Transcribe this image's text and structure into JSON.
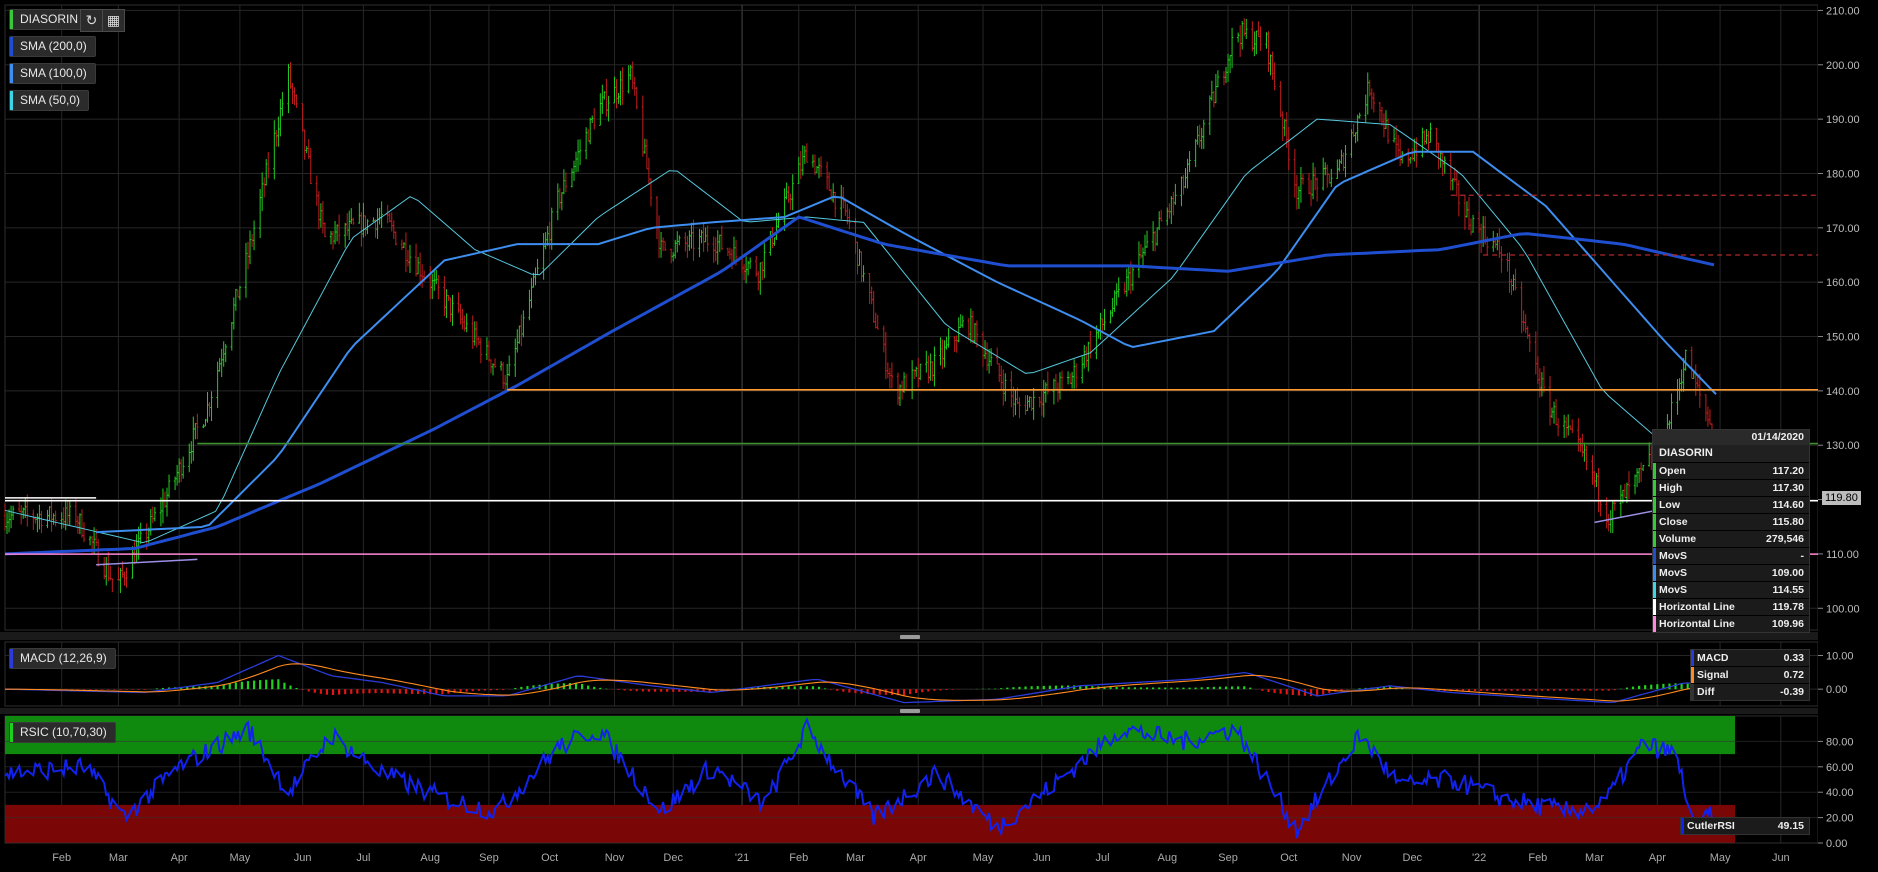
{
  "toolbar": {
    "symbol": "DIASORIN",
    "symbol_color": "#39c739",
    "indicators": [
      {
        "label": "SMA (200,0)",
        "color": "#1f4fd0"
      },
      {
        "label": "SMA (100,0)",
        "color": "#3d8ef0"
      },
      {
        "label": "SMA (50,0)",
        "color": "#3ed6e6"
      }
    ],
    "refresh_icon": "refresh-icon",
    "calendar_icon": "calendar-icon"
  },
  "colors": {
    "up": "#22cc22",
    "down": "#c21e1e",
    "grid": "#2c2c2c",
    "sma200": "#1f4fd0",
    "sma100": "#3d8ef0",
    "sma50": "#55c9dd",
    "orange_line": "#ff9933",
    "green_line": "#3e8f2e",
    "white_line": "#ffffff",
    "pink_line": "#ff88d8",
    "purple_line": "#9b8fe6",
    "red_dash": "#b02a2a",
    "macd": "#2a3bd8",
    "signal": "#ff8a1f",
    "rsi": "#1222ee",
    "overbought": "#0f8a0f",
    "oversold": "#7a0606"
  },
  "info_panel": {
    "date": "01/14/2020",
    "symbol": "DIASORIN",
    "rows": [
      {
        "label": "Open",
        "value": "117.20",
        "color": "#33cc33"
      },
      {
        "label": "High",
        "value": "117.30",
        "color": "#33cc33"
      },
      {
        "label": "Low",
        "value": "114.60",
        "color": "#33cc33"
      },
      {
        "label": "Close",
        "value": "115.80",
        "color": "#33cc33"
      },
      {
        "label": "Volume",
        "value": "279,546",
        "color": "#33cc33"
      },
      {
        "label": "MovS",
        "value": "-",
        "color": "#1f4fd0"
      },
      {
        "label": "MovS",
        "value": "109.00",
        "color": "#3d8ef0"
      },
      {
        "label": "MovS",
        "value": "114.55",
        "color": "#3ed6e6"
      },
      {
        "label": "Horizontal Line",
        "value": "119.78",
        "color": "#ffffff"
      },
      {
        "label": "Horizontal Line",
        "value": "109.96",
        "color": "#ff88d8"
      }
    ]
  },
  "price_tag": "119.80",
  "macd_panel": {
    "label": "MACD (12,26,9)",
    "label_color": "#2a3bd8",
    "rows": [
      {
        "label": "MACD",
        "value": "0.33",
        "color": "#2a3bd8"
      },
      {
        "label": "Signal",
        "value": "0.72",
        "color": "#ff8a1f"
      },
      {
        "label": "Diff",
        "value": "-0.39",
        "color": "#333333"
      }
    ]
  },
  "rsi_panel": {
    "label": "RSIC (10,70,30)",
    "label_color": "#1fd01f",
    "row": {
      "label": "CutlerRSI",
      "value": "49.15",
      "color": "#1222ee"
    }
  },
  "chart_data": {
    "type": "candlestick",
    "title": "DIASORIN",
    "x_tick_labels": [
      "Feb",
      "Mar",
      "Apr",
      "May",
      "Jun",
      "Jul",
      "Aug",
      "Sep",
      "Oct",
      "Nov",
      "Dec",
      "'21",
      "Feb",
      "Mar",
      "Apr",
      "May",
      "Jun",
      "Jul",
      "Aug",
      "Sep",
      "Oct",
      "Nov",
      "Dec",
      "'22",
      "Feb",
      "Mar",
      "Apr",
      "May",
      "Jun"
    ],
    "y_ticks": [
      "100.00",
      "110.00",
      "120.00",
      "130.00",
      "140.00",
      "150.00",
      "160.00",
      "170.00",
      "180.00",
      "190.00",
      "200.00",
      "210.00"
    ],
    "ylim": [
      96,
      211
    ],
    "price_path": [
      {
        "x": "2020-01-06",
        "y": 117
      },
      {
        "x": "2020-02-10",
        "y": 117
      },
      {
        "x": "2020-03-01",
        "y": 104
      },
      {
        "x": "2020-03-25",
        "y": 120
      },
      {
        "x": "2020-04-15",
        "y": 137
      },
      {
        "x": "2020-05-05",
        "y": 165
      },
      {
        "x": "2020-05-25",
        "y": 198
      },
      {
        "x": "2020-06-12",
        "y": 168
      },
      {
        "x": "2020-07-10",
        "y": 172
      },
      {
        "x": "2020-08-01",
        "y": 161
      },
      {
        "x": "2020-08-20",
        "y": 152
      },
      {
        "x": "2020-09-10",
        "y": 142
      },
      {
        "x": "2020-10-05",
        "y": 175
      },
      {
        "x": "2020-10-25",
        "y": 192
      },
      {
        "x": "2020-11-10",
        "y": 198
      },
      {
        "x": "2020-11-25",
        "y": 166
      },
      {
        "x": "2020-12-20",
        "y": 168
      },
      {
        "x": "2021-01-12",
        "y": 162
      },
      {
        "x": "2021-02-05",
        "y": 184
      },
      {
        "x": "2021-02-25",
        "y": 172
      },
      {
        "x": "2021-03-20",
        "y": 140
      },
      {
        "x": "2021-04-10",
        "y": 145
      },
      {
        "x": "2021-04-25",
        "y": 153
      },
      {
        "x": "2021-05-20",
        "y": 137
      },
      {
        "x": "2021-06-15",
        "y": 142
      },
      {
        "x": "2021-07-10",
        "y": 158
      },
      {
        "x": "2021-08-10",
        "y": 178
      },
      {
        "x": "2021-09-05",
        "y": 206
      },
      {
        "x": "2021-09-20",
        "y": 204
      },
      {
        "x": "2021-10-05",
        "y": 177
      },
      {
        "x": "2021-10-25",
        "y": 180
      },
      {
        "x": "2021-11-10",
        "y": 196
      },
      {
        "x": "2021-11-25",
        "y": 182
      },
      {
        "x": "2021-12-10",
        "y": 187
      },
      {
        "x": "2021-12-28",
        "y": 172
      },
      {
        "x": "2022-01-15",
        "y": 165
      },
      {
        "x": "2022-02-05",
        "y": 138
      },
      {
        "x": "2022-02-25",
        "y": 127
      },
      {
        "x": "2022-03-08",
        "y": 117
      },
      {
        "x": "2022-03-25",
        "y": 125
      },
      {
        "x": "2022-04-05",
        "y": 132
      },
      {
        "x": "2022-04-15",
        "y": 146
      },
      {
        "x": "2022-04-28",
        "y": 133
      }
    ],
    "sma50": [
      {
        "x": "2020-01-06",
        "y": 118
      },
      {
        "x": "2020-03-15",
        "y": 112
      },
      {
        "x": "2020-04-20",
        "y": 118
      },
      {
        "x": "2020-05-20",
        "y": 143
      },
      {
        "x": "2020-06-25",
        "y": 168
      },
      {
        "x": "2020-07-25",
        "y": 176
      },
      {
        "x": "2020-08-25",
        "y": 166
      },
      {
        "x": "2020-09-25",
        "y": 161
      },
      {
        "x": "2020-10-25",
        "y": 172
      },
      {
        "x": "2020-12-01",
        "y": 181
      },
      {
        "x": "2021-01-05",
        "y": 171
      },
      {
        "x": "2021-02-05",
        "y": 172
      },
      {
        "x": "2021-03-05",
        "y": 171
      },
      {
        "x": "2021-04-15",
        "y": 152
      },
      {
        "x": "2021-05-25",
        "y": 143
      },
      {
        "x": "2021-06-25",
        "y": 147
      },
      {
        "x": "2021-08-05",
        "y": 161
      },
      {
        "x": "2021-09-10",
        "y": 180
      },
      {
        "x": "2021-10-15",
        "y": 190
      },
      {
        "x": "2021-11-20",
        "y": 189
      },
      {
        "x": "2021-12-25",
        "y": 180
      },
      {
        "x": "2022-01-25",
        "y": 166
      },
      {
        "x": "2022-03-05",
        "y": 140
      },
      {
        "x": "2022-04-05",
        "y": 130
      },
      {
        "x": "2022-04-28",
        "y": 131
      }
    ],
    "sma100": [
      {
        "x": "2020-02-20",
        "y": 114
      },
      {
        "x": "2020-04-15",
        "y": 115
      },
      {
        "x": "2020-05-20",
        "y": 128
      },
      {
        "x": "2020-06-25",
        "y": 148
      },
      {
        "x": "2020-08-10",
        "y": 164
      },
      {
        "x": "2020-09-15",
        "y": 167
      },
      {
        "x": "2020-10-25",
        "y": 167
      },
      {
        "x": "2020-11-20",
        "y": 170
      },
      {
        "x": "2020-12-20",
        "y": 171
      },
      {
        "x": "2021-01-25",
        "y": 172
      },
      {
        "x": "2021-02-20",
        "y": 176
      },
      {
        "x": "2021-03-25",
        "y": 169
      },
      {
        "x": "2021-05-10",
        "y": 160
      },
      {
        "x": "2021-06-20",
        "y": 153
      },
      {
        "x": "2021-07-15",
        "y": 148
      },
      {
        "x": "2021-08-25",
        "y": 151
      },
      {
        "x": "2021-09-25",
        "y": 162
      },
      {
        "x": "2021-10-25",
        "y": 178
      },
      {
        "x": "2021-12-01",
        "y": 184
      },
      {
        "x": "2021-12-31",
        "y": 184
      },
      {
        "x": "2022-02-05",
        "y": 174
      },
      {
        "x": "2022-03-10",
        "y": 160
      },
      {
        "x": "2022-04-05",
        "y": 149
      },
      {
        "x": "2022-05-01",
        "y": 139
      }
    ],
    "sma200": [
      {
        "x": "2020-01-06",
        "y": 110
      },
      {
        "x": "2020-03-10",
        "y": 111
      },
      {
        "x": "2020-04-20",
        "y": 115
      },
      {
        "x": "2020-06-10",
        "y": 123
      },
      {
        "x": "2020-08-05",
        "y": 133
      },
      {
        "x": "2020-09-15",
        "y": 141
      },
      {
        "x": "2020-11-01",
        "y": 151
      },
      {
        "x": "2020-12-25",
        "y": 162
      },
      {
        "x": "2021-02-01",
        "y": 172
      },
      {
        "x": "2021-03-15",
        "y": 167
      },
      {
        "x": "2021-05-15",
        "y": 163
      },
      {
        "x": "2021-07-15",
        "y": 163
      },
      {
        "x": "2021-09-01",
        "y": 162
      },
      {
        "x": "2021-10-20",
        "y": 165
      },
      {
        "x": "2021-12-15",
        "y": 166
      },
      {
        "x": "2022-01-25",
        "y": 169
      },
      {
        "x": "2022-03-15",
        "y": 167
      },
      {
        "x": "2022-05-01",
        "y": 163
      }
    ],
    "horizontal_lines": [
      {
        "y": 140.2,
        "x_from": "2020-09-10",
        "color": "orange"
      },
      {
        "y": 130.3,
        "x_from": "2020-04-10",
        "color": "green"
      },
      {
        "y": 119.78,
        "x_from": "2020-01-06",
        "color": "white"
      },
      {
        "y": 109.96,
        "x_from": "2020-01-06",
        "color": "pink"
      },
      {
        "y": 176,
        "x_from": "2021-12-20",
        "color": "red-dashed"
      },
      {
        "y": 165,
        "x_from": "2022-01-05",
        "color": "red-dashed"
      }
    ],
    "trend_lines": [
      {
        "from": {
          "x": "2020-01-06",
          "y": 120.3
        },
        "to": {
          "x": "2020-02-20",
          "y": 120.3
        },
        "color": "white"
      },
      {
        "from": {
          "x": "2020-02-20",
          "y": 108
        },
        "to": {
          "x": "2020-04-10",
          "y": 109
        },
        "color": "purple"
      },
      {
        "from": {
          "x": "2022-03-01",
          "y": 115.8
        },
        "to": {
          "x": "2022-04-28",
          "y": 120
        },
        "color": "purple"
      }
    ],
    "macd": {
      "ylim": [
        -5,
        14
      ],
      "y_ticks": [
        "0.00",
        "10.00"
      ],
      "macd_path": [
        {
          "x": "2020-01-06",
          "y": 0
        },
        {
          "x": "2020-03-15",
          "y": -1
        },
        {
          "x": "2020-04-20",
          "y": 2
        },
        {
          "x": "2020-05-20",
          "y": 10
        },
        {
          "x": "2020-06-15",
          "y": 4
        },
        {
          "x": "2020-07-10",
          "y": 2
        },
        {
          "x": "2020-08-10",
          "y": -2
        },
        {
          "x": "2020-09-10",
          "y": -2
        },
        {
          "x": "2020-10-15",
          "y": 4
        },
        {
          "x": "2020-11-20",
          "y": 1
        },
        {
          "x": "2020-12-20",
          "y": -1
        },
        {
          "x": "2021-02-10",
          "y": 3
        },
        {
          "x": "2021-03-25",
          "y": -4
        },
        {
          "x": "2021-05-10",
          "y": -3
        },
        {
          "x": "2021-06-20",
          "y": 1
        },
        {
          "x": "2021-08-15",
          "y": 3
        },
        {
          "x": "2021-09-10",
          "y": 5
        },
        {
          "x": "2021-10-15",
          "y": -2
        },
        {
          "x": "2021-11-20",
          "y": 1
        },
        {
          "x": "2021-12-20",
          "y": -1
        },
        {
          "x": "2022-02-10",
          "y": -3
        },
        {
          "x": "2022-03-10",
          "y": -4
        },
        {
          "x": "2022-04-15",
          "y": 2
        },
        {
          "x": "2022-04-28",
          "y": 0.3
        }
      ]
    },
    "rsi": {
      "ylim": [
        0,
        100
      ],
      "y_ticks": [
        "0.00",
        "20.00",
        "40.00",
        "60.00",
        "80.00"
      ],
      "overbought": 70,
      "oversold": 30,
      "rsi_path": [
        {
          "x": "2020-01-06",
          "y": 55
        },
        {
          "x": "2020-02-15",
          "y": 60
        },
        {
          "x": "2020-03-05",
          "y": 20
        },
        {
          "x": "2020-04-01",
          "y": 60
        },
        {
          "x": "2020-05-05",
          "y": 90
        },
        {
          "x": "2020-05-25",
          "y": 40
        },
        {
          "x": "2020-06-15",
          "y": 85
        },
        {
          "x": "2020-07-10",
          "y": 55
        },
        {
          "x": "2020-08-10",
          "y": 35
        },
        {
          "x": "2020-09-05",
          "y": 25
        },
        {
          "x": "2020-10-05",
          "y": 75
        },
        {
          "x": "2020-10-25",
          "y": 90
        },
        {
          "x": "2020-11-25",
          "y": 25
        },
        {
          "x": "2020-12-20",
          "y": 60
        },
        {
          "x": "2021-01-15",
          "y": 30
        },
        {
          "x": "2021-02-05",
          "y": 90
        },
        {
          "x": "2021-03-10",
          "y": 20
        },
        {
          "x": "2021-04-10",
          "y": 55
        },
        {
          "x": "2021-05-10",
          "y": 12
        },
        {
          "x": "2021-06-10",
          "y": 50
        },
        {
          "x": "2021-07-10",
          "y": 90
        },
        {
          "x": "2021-08-10",
          "y": 80
        },
        {
          "x": "2021-09-05",
          "y": 90
        },
        {
          "x": "2021-10-05",
          "y": 10
        },
        {
          "x": "2021-11-05",
          "y": 85
        },
        {
          "x": "2021-11-25",
          "y": 45
        },
        {
          "x": "2021-12-20",
          "y": 50
        },
        {
          "x": "2022-01-15",
          "y": 35
        },
        {
          "x": "2022-02-15",
          "y": 25
        },
        {
          "x": "2022-03-05",
          "y": 30
        },
        {
          "x": "2022-03-25",
          "y": 78
        },
        {
          "x": "2022-04-10",
          "y": 70
        },
        {
          "x": "2022-04-20",
          "y": 10
        },
        {
          "x": "2022-04-28",
          "y": 25
        }
      ]
    }
  }
}
